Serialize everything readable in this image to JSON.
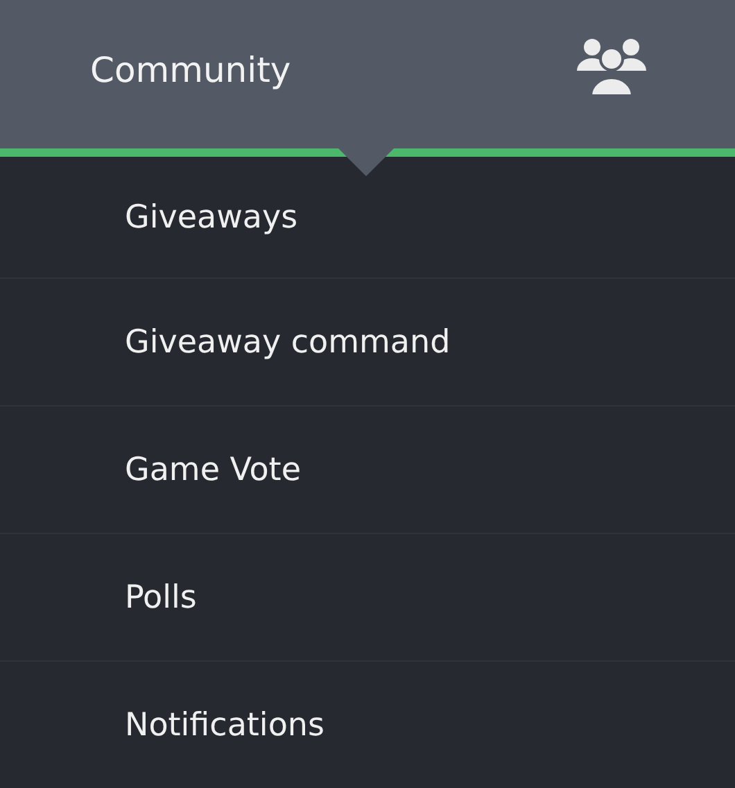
{
  "header": {
    "title": "Community",
    "expanded": true
  },
  "menu_items": [
    {
      "label": "Giveaways"
    },
    {
      "label": "Giveaway command"
    },
    {
      "label": "Game Vote"
    },
    {
      "label": "Polls"
    },
    {
      "label": "Notifications"
    }
  ]
}
